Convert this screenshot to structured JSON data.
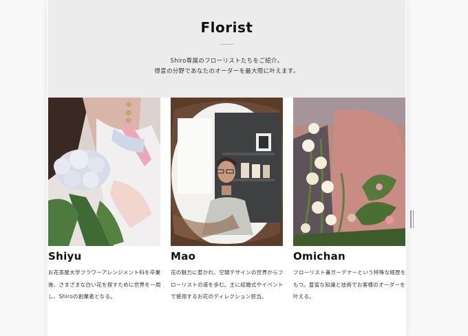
{
  "section": {
    "title": "Florist",
    "intro_line1": "Shiro専属のフローリストたちをご紹介。",
    "intro_line2": "得意の分野であなたのオーダーを最大限に叶えます。"
  },
  "florists": [
    {
      "name": "Shiyu",
      "desc": "お花茶屋大学フラワーアレンジメント科を卒業後、さまざまな白い花を探すために世界を一周し、Shiroの創業者となる。"
    },
    {
      "name": "Mao",
      "desc": "花の魅力に惹かれ、空間デザインの世界からフローリストの道を歩む。主に結婚式やイベントで使用するお花のディレクション担当。"
    },
    {
      "name": "Omichan",
      "desc": "フローリスト兼ガーデナーという特殊な経歴をもつ。豊富な知識と技術でお客様のオーダーを叶える。"
    }
  ]
}
